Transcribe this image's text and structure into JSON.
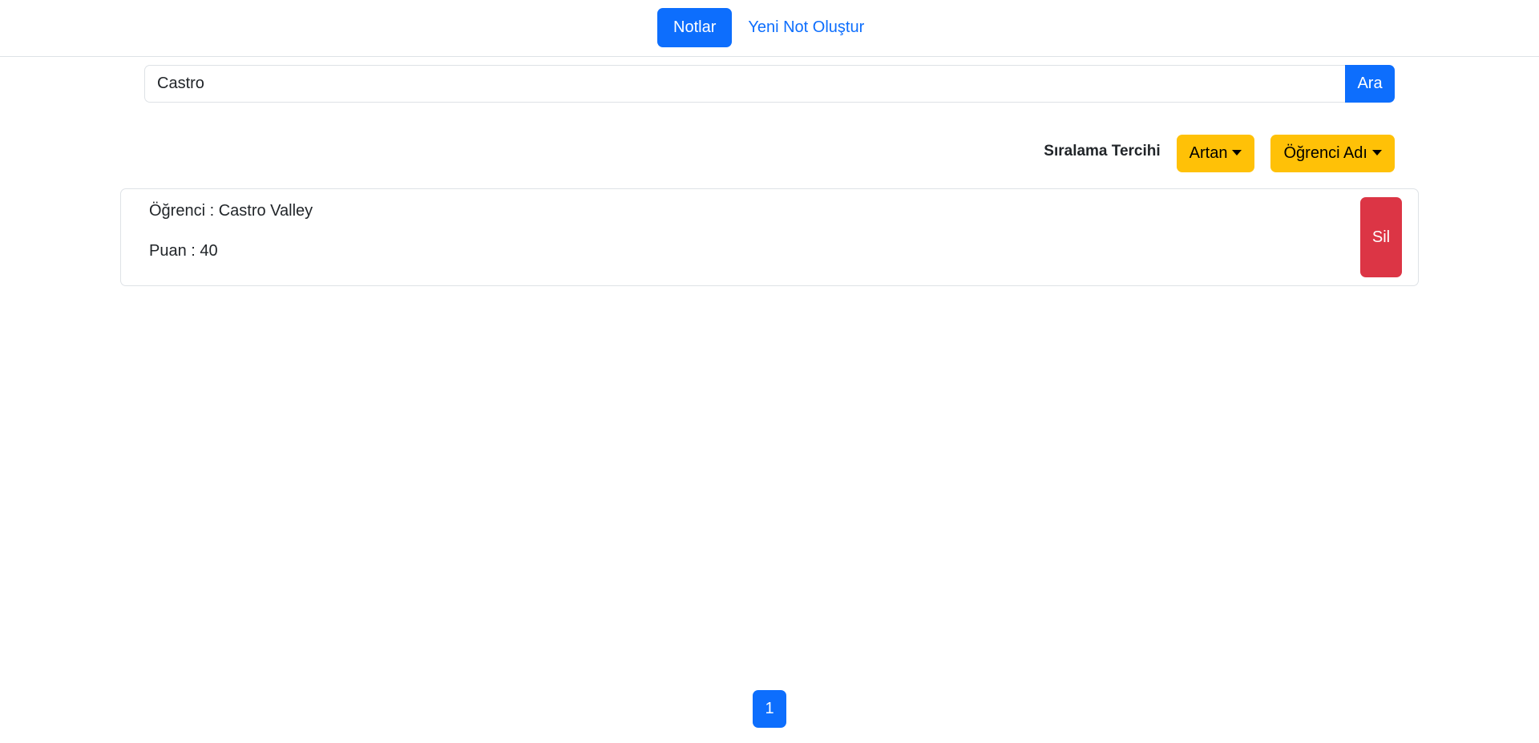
{
  "nav": {
    "items": [
      {
        "label": "Notlar",
        "active": true
      },
      {
        "label": "Yeni Not Oluştur",
        "active": false
      }
    ]
  },
  "search": {
    "value": "Castro",
    "button_label": "Ara"
  },
  "sort": {
    "label": "Sıralama Tercihi",
    "order_label": "Artan",
    "field_label": "Öğrenci Adı"
  },
  "notes": [
    {
      "student_line": "Öğrenci : Castro Valley",
      "score_line": "Puan : 40",
      "delete_label": "Sil"
    }
  ],
  "pagination": {
    "pages": [
      "1"
    ]
  },
  "colors": {
    "primary": "#0d6efd",
    "warning": "#ffc107",
    "danger": "#dc3545",
    "border": "#dee2e6"
  }
}
